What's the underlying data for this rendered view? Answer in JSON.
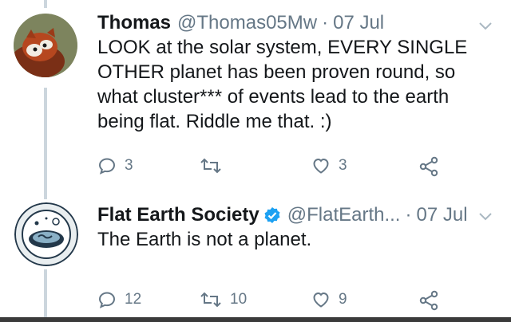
{
  "tweets": [
    {
      "display_name": "Thomas",
      "handle": "@Thomas05Mw",
      "separator": "·",
      "date": "07 Jul",
      "verified": false,
      "avatar_icon": "red-panda-avatar",
      "text": "LOOK at the solar system, EVERY SINGLE OTHER planet has been proven round, so what cluster*** of events lead to the earth being flat. Riddle me that. :)",
      "actions": {
        "reply_count": "3",
        "retweet_count": "",
        "like_count": "3"
      }
    },
    {
      "display_name": "Flat Earth Society",
      "handle": "@FlatEarth...",
      "separator": "·",
      "date": "07 Jul",
      "verified": true,
      "avatar_icon": "flat-earth-logo-avatar",
      "text": "The Earth is not a planet.",
      "actions": {
        "reply_count": "12",
        "retweet_count": "10",
        "like_count": "9"
      }
    }
  ],
  "colors": {
    "text": "#14171a",
    "muted": "#657786",
    "verified": "#1da1f2",
    "thread_line": "#ccd6dd"
  }
}
